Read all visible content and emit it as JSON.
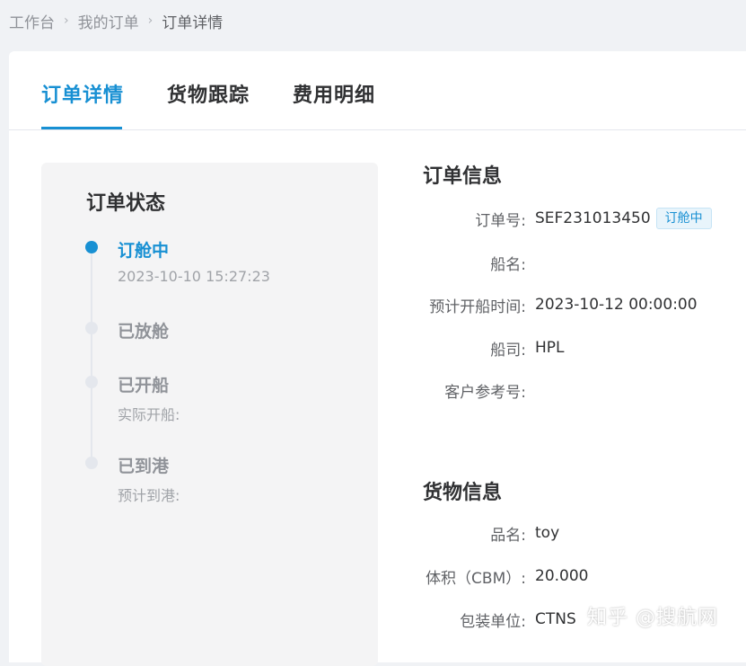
{
  "breadcrumb": {
    "items": [
      "工作台",
      "我的订单",
      "订单详情"
    ],
    "separator": "›"
  },
  "tabs": [
    {
      "label": "订单详情",
      "active": true
    },
    {
      "label": "货物跟踪",
      "active": false
    },
    {
      "label": "费用明细",
      "active": false
    }
  ],
  "status": {
    "title": "订单状态",
    "steps": [
      {
        "title": "订舱中",
        "sub": "2023-10-10 15:27:23",
        "active": true
      },
      {
        "title": "已放舱",
        "sub": "",
        "active": false
      },
      {
        "title": "已开船",
        "sub": "实际开船:",
        "active": false
      },
      {
        "title": "已到港",
        "sub": "预计到港:",
        "active": false
      }
    ]
  },
  "order_info": {
    "title": "订单信息",
    "order_no_label": "订单号:",
    "order_no": "SEF231013450",
    "order_badge": "订舱中",
    "ship_name_label": "船名:",
    "ship_name": "",
    "etd_label": "预计开船时间:",
    "etd": "2023-10-12 00:00:00",
    "carrier_label": "船司:",
    "carrier": "HPL",
    "customer_ref_label": "客户参考号:",
    "customer_ref": ""
  },
  "cargo_info": {
    "title": "货物信息",
    "name_label": "品名:",
    "name": "toy",
    "volume_label": "体积（CBM）:",
    "volume": "20.000",
    "unit_label": "包装单位:",
    "unit": "CTNS"
  },
  "watermark": "知乎 @搜航网",
  "colors": {
    "accent": "#1890d3",
    "page_bg": "#f0f2f5",
    "panel_bg": "#f4f4f5",
    "inactive_dot": "#e4e7ed"
  }
}
